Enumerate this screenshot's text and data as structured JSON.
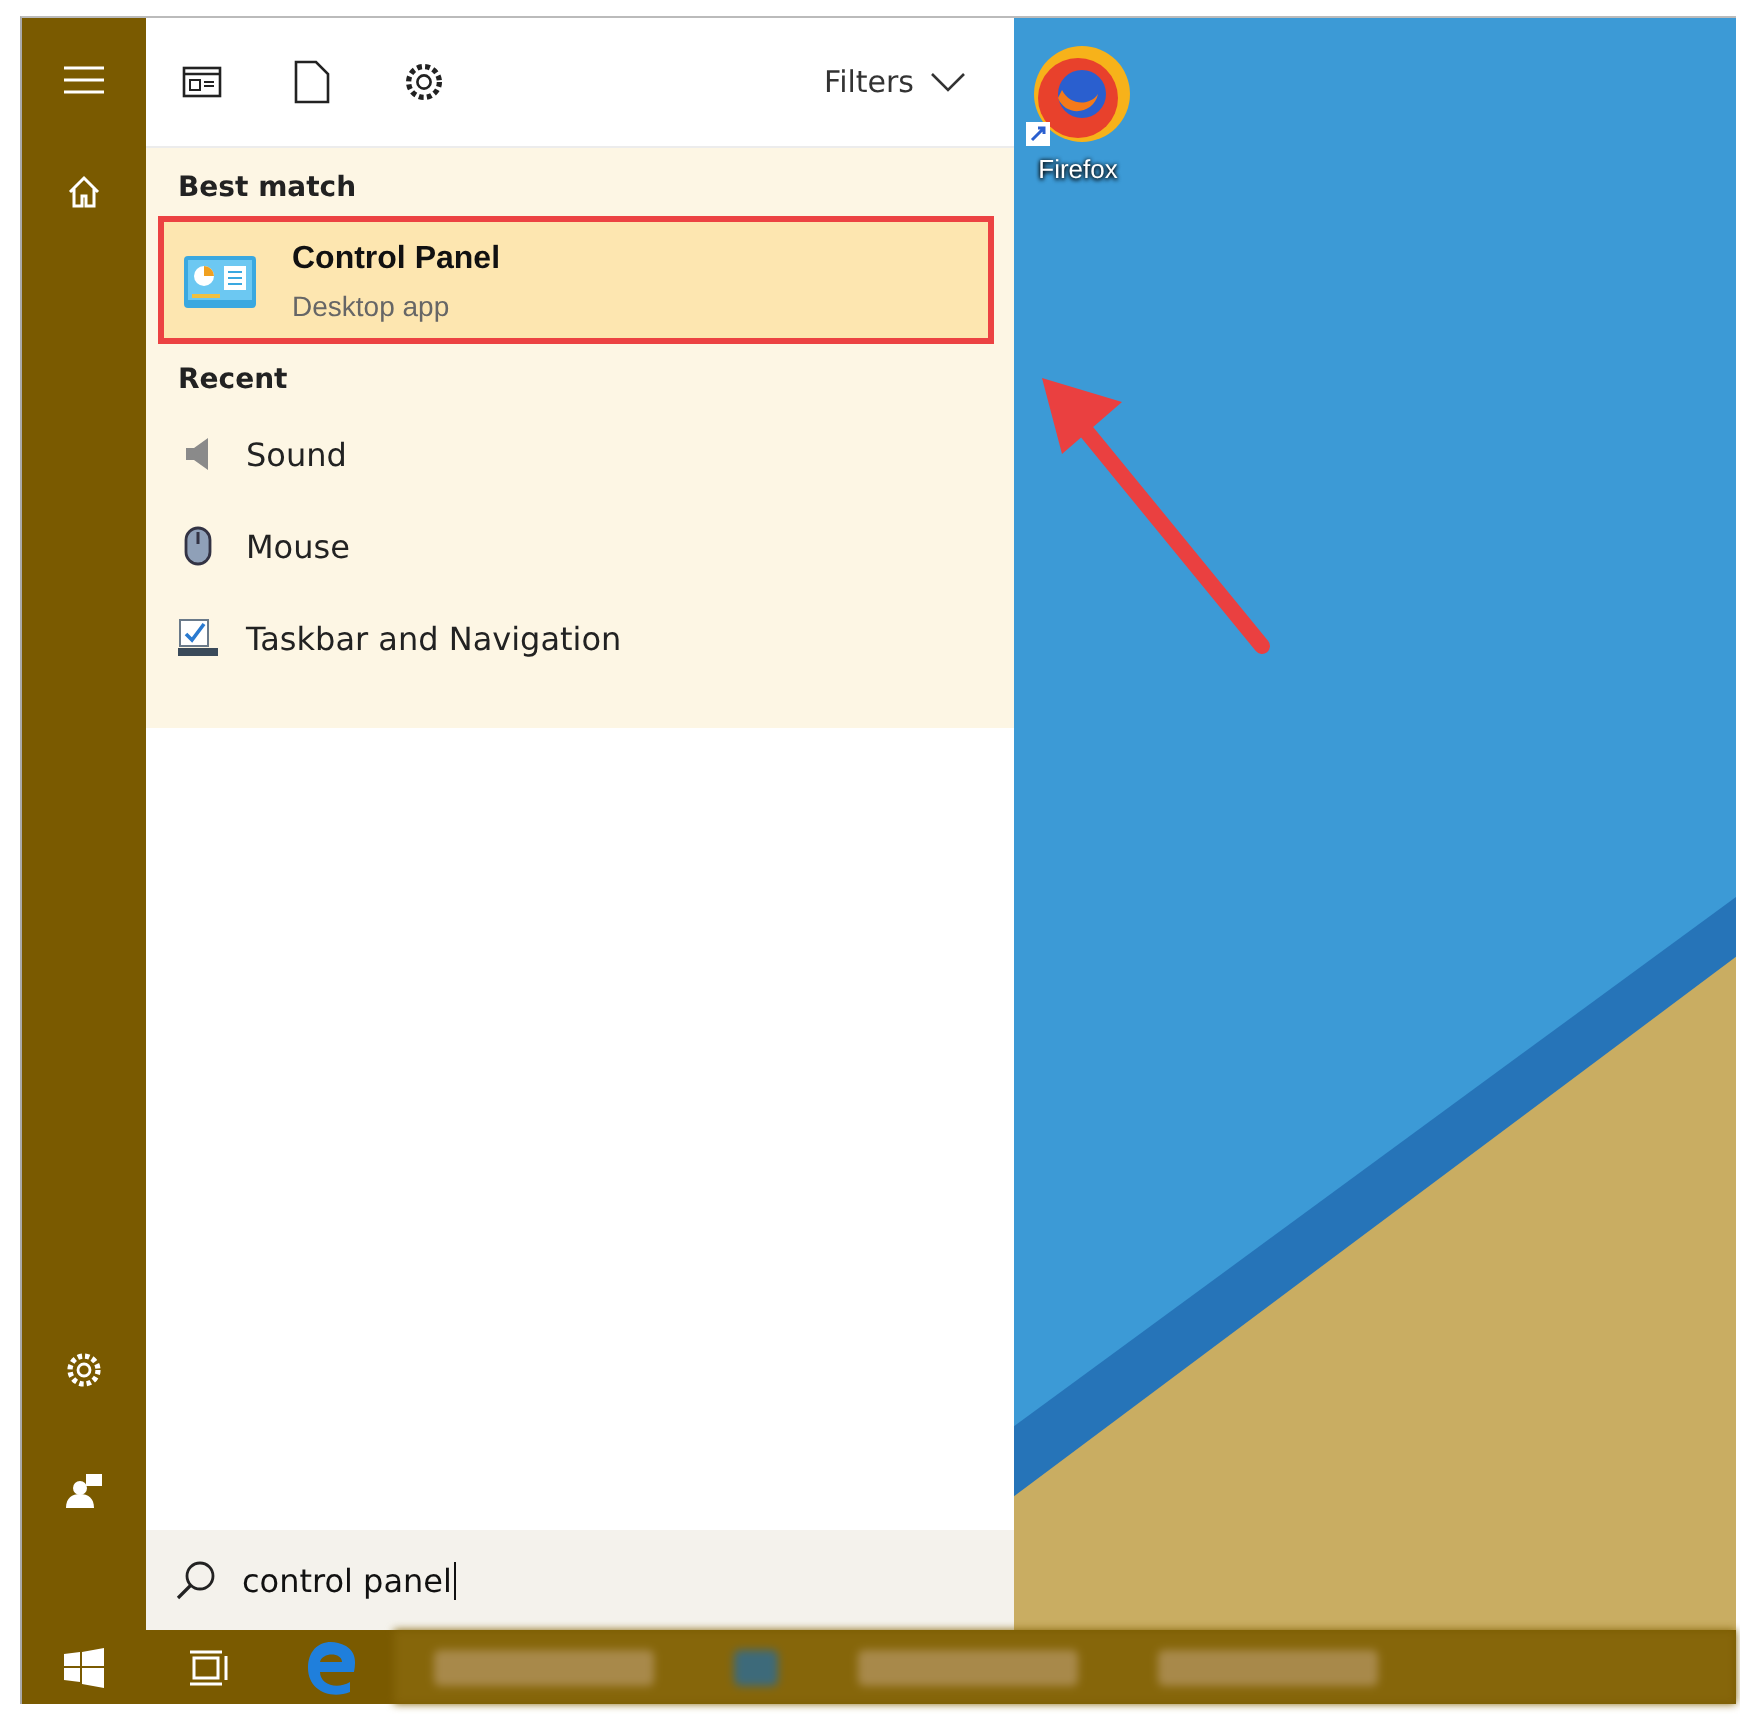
{
  "toolbar": {
    "filters_label": "Filters"
  },
  "best_match": {
    "heading": "Best match",
    "item": {
      "title": "Control Panel",
      "subtitle": "Desktop app",
      "selected": true
    }
  },
  "recent": {
    "heading": "Recent",
    "items": [
      {
        "kind": "sound",
        "label": "Sound"
      },
      {
        "kind": "mouse",
        "label": "Mouse"
      },
      {
        "kind": "taskbar",
        "label": "Taskbar and Navigation"
      }
    ]
  },
  "search": {
    "value": "control panel"
  },
  "desktop": {
    "icons": [
      {
        "label": "Firefox"
      }
    ]
  }
}
